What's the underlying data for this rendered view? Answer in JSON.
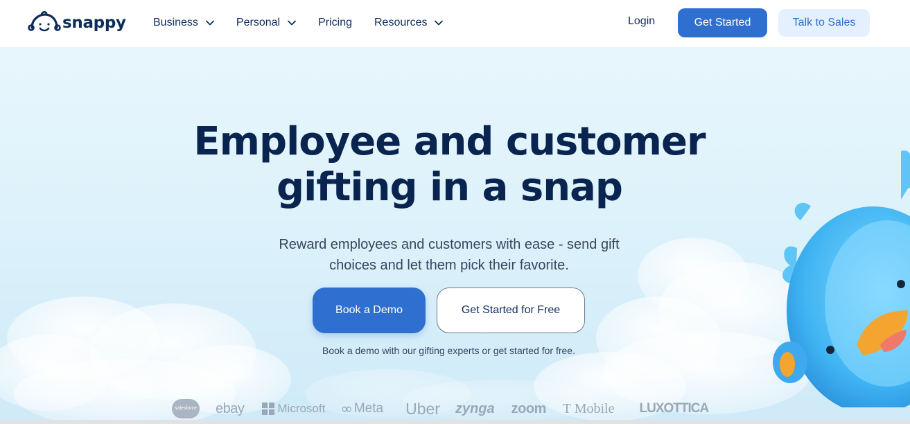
{
  "header": {
    "logo_text": "snappy",
    "nav": [
      {
        "label": "Business",
        "has_dropdown": true
      },
      {
        "label": "Personal",
        "has_dropdown": true
      },
      {
        "label": "Pricing",
        "has_dropdown": false
      },
      {
        "label": "Resources",
        "has_dropdown": true
      }
    ],
    "login_label": "Login",
    "get_started_label": "Get Started",
    "talk_sales_label": "Talk to Sales"
  },
  "hero": {
    "title_line1": "Employee and customer",
    "title_line2": "gifting in a snap",
    "subtitle": "Reward employees and customers with ease - send gift choices and let them pick their favorite.",
    "primary_cta": "Book a Demo",
    "secondary_cta": "Get Started for Free",
    "note": "Book a demo with our gifting experts or get started for free."
  },
  "brands": {
    "salesforce": "salesforce",
    "ebay": "ebay",
    "microsoft": "Microsoft",
    "meta": "Meta",
    "uber": "Uber",
    "zynga": "zynga",
    "zoom": "zoom",
    "tmobile": "T Mobile",
    "luxottica": "LUXOTTICA"
  },
  "colors": {
    "primary": "#2f6fd0",
    "navy": "#0a2450",
    "secondary_button_bg": "#e4efff",
    "hero_bg": "#ddf2fb",
    "brand_logo_gray": "#9aa7b6"
  }
}
